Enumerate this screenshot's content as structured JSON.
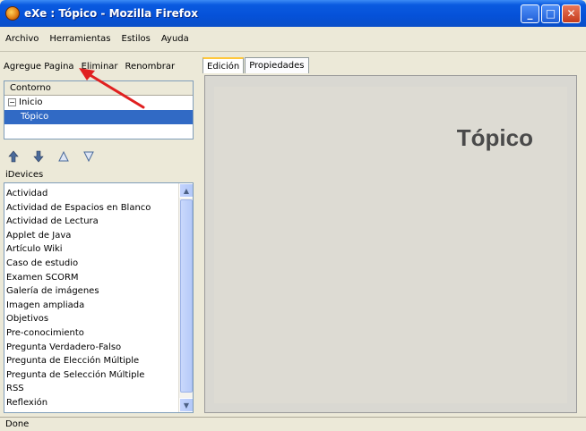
{
  "window": {
    "title": "eXe : Tópico - Mozilla Firefox",
    "controls": [
      "minimize-icon",
      "maximize-icon",
      "close-icon"
    ]
  },
  "menu": {
    "items": [
      "Archivo",
      "Herramientas",
      "Estilos",
      "Ayuda"
    ]
  },
  "outline": {
    "actions": [
      "Agregue Pagina",
      "Eliminar",
      "Renombrar"
    ],
    "header": "Contorno",
    "tree": [
      {
        "label": "Inicio",
        "expanded": true
      },
      {
        "label": "Tópico",
        "selected": true
      }
    ]
  },
  "arrow_toolbar": {
    "icons": [
      "promote-icon",
      "demote-icon",
      "move-up-icon",
      "move-down-icon"
    ]
  },
  "devices": {
    "label": "iDevices",
    "items": [
      "Actividad",
      "Actividad de Espacios en Blanco",
      "Actividad de Lectura",
      "Applet de Java",
      "Artículo Wiki",
      "Caso de estudio",
      "Examen SCORM",
      "Galería de imágenes",
      "Imagen ampliada",
      "Objetivos",
      "Pre-conocimiento",
      "Pregunta Verdadero-Falso",
      "Pregunta de Elección Múltiple",
      "Pregunta de Selección Múltiple",
      "RSS",
      "Reflexión"
    ]
  },
  "tabs": {
    "items": [
      "Edición",
      "Propiedades"
    ],
    "active": "Edición"
  },
  "content": {
    "heading": "Tópico"
  },
  "status": {
    "text": "Done"
  },
  "colors": {
    "titlebar": "#0551d8",
    "selection": "#316ac5",
    "annotation_arrow": "#e02020"
  }
}
